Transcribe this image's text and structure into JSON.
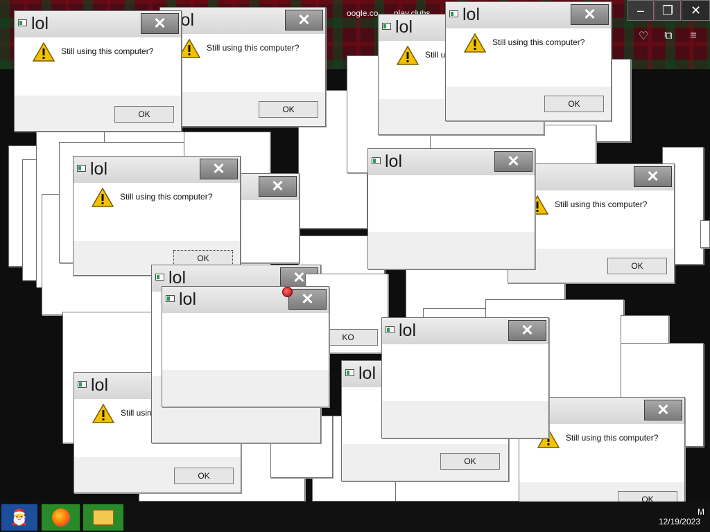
{
  "browser": {
    "url_fragment_1": "oogle.co",
    "url_fragment_2": "play.clubs",
    "controls": {
      "minimize": "–",
      "restore": "❐",
      "close": "✕"
    }
  },
  "dialog_common": {
    "title": "lol",
    "message": "Still using this computer?",
    "ok_label": "OK",
    "close_glyph": "✕"
  },
  "dialogs": [
    {
      "id": "d01",
      "title": "lol",
      "message": "Still using this computer?",
      "ok": "OK"
    },
    {
      "id": "d02",
      "title": "lol",
      "message": "Still using this computer?",
      "ok": "OK"
    },
    {
      "id": "d03",
      "title": "lol",
      "message": "Still using this computer?",
      "ok": "OK"
    },
    {
      "id": "d04",
      "title": "lol",
      "message": "Still using this computer?",
      "ok": "OK"
    },
    {
      "id": "d05",
      "title": "lol",
      "message": "Still using this computer?",
      "ok": "OK"
    },
    {
      "id": "d06",
      "title": "lol",
      "message": "Still using this computer?",
      "ok": "OK"
    },
    {
      "id": "d07",
      "title": "lol",
      "message": "Still using this computer?",
      "ok": "OK"
    },
    {
      "id": "d08",
      "title": "lol",
      "message": "Still using this computer?",
      "ok": "OK"
    },
    {
      "id": "d09",
      "title": "lol",
      "message": "Still using this computer?",
      "ok": "OK"
    },
    {
      "id": "d10",
      "title": "lol",
      "message": "Still using this computer?",
      "ok": "KO"
    }
  ],
  "taskbar": {
    "start_icon": "santa-start-icon",
    "apps": [
      "firefox-icon",
      "file-explorer-icon"
    ],
    "time": "M",
    "date": "12/19/2023"
  },
  "colors": {
    "dialog_bg": "#ffffff",
    "titlebar": "#d9d9d9",
    "close_button": "#8c8c8c",
    "footer": "#efefef",
    "taskbar": "#111111",
    "warning": "#f2c200"
  }
}
